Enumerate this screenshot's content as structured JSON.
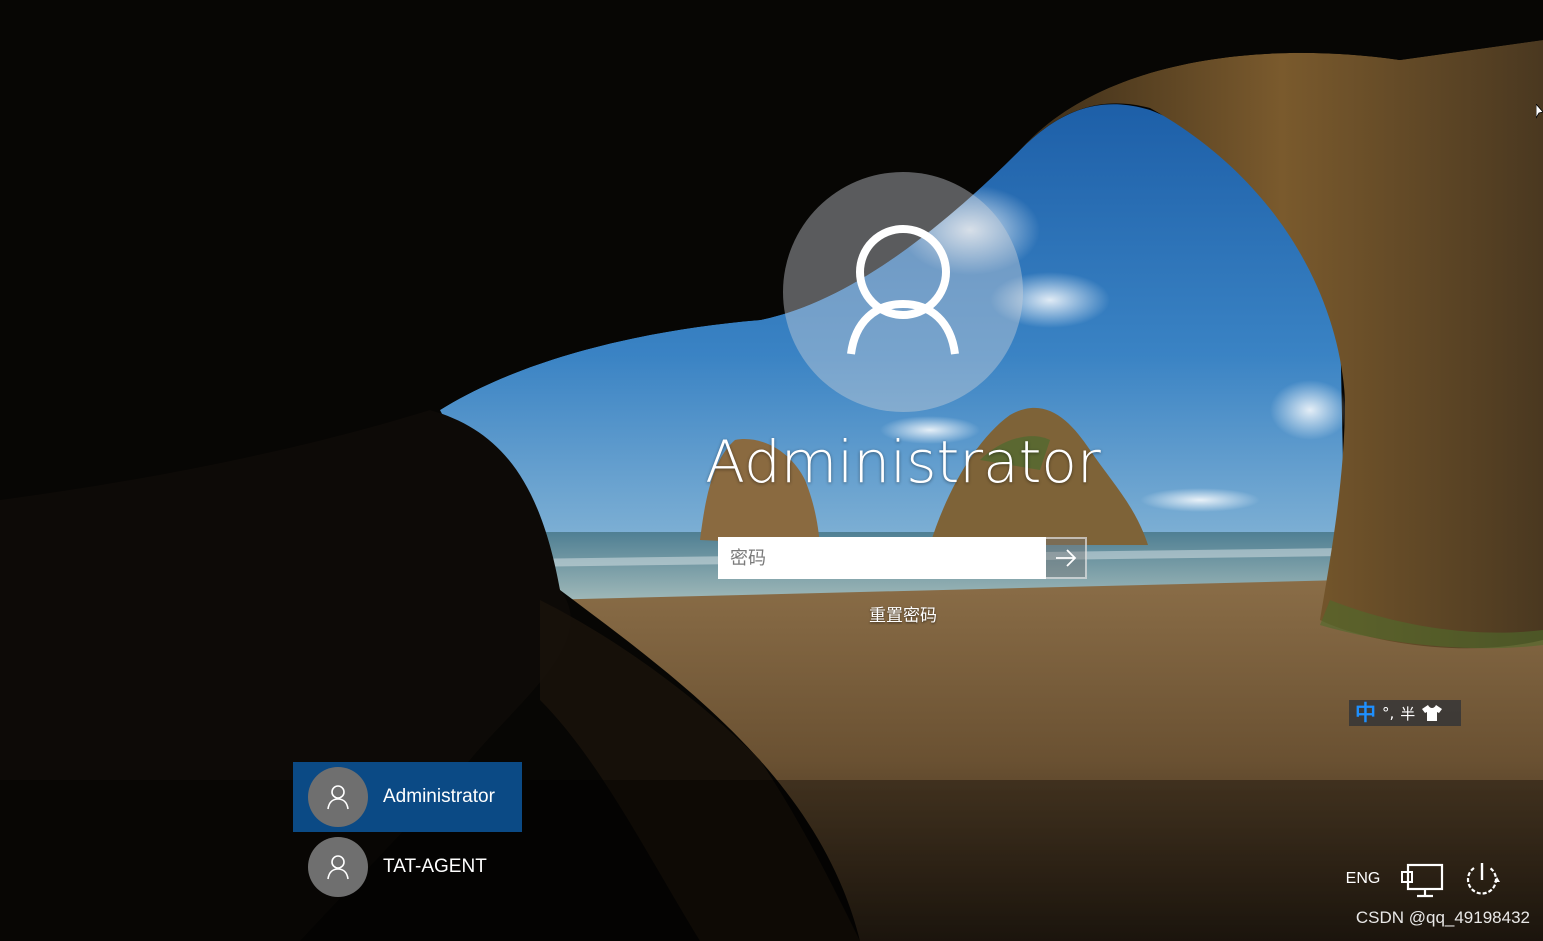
{
  "login": {
    "username": "Administrator",
    "password_placeholder": "密码",
    "password_value": "",
    "reset_password": "重置密码"
  },
  "users": [
    {
      "name": "Administrator",
      "selected": true
    },
    {
      "name": "TAT-AGENT",
      "selected": false
    }
  ],
  "ime": {
    "mode": "中",
    "punctuation": "°,",
    "width": "半"
  },
  "tray": {
    "language": "ENG"
  },
  "watermark": "CSDN @qq_49198432",
  "icons": {
    "submit": "arrow-right-icon",
    "user": "user-silhouette-icon",
    "network": "network-monitor-icon",
    "power": "power-icon",
    "ime_skin": "shirt-icon"
  },
  "colors": {
    "selected_tile": "#0b4a85",
    "ime_mode": "#1e90ff",
    "mini_avatar": "#6f6f6f"
  }
}
